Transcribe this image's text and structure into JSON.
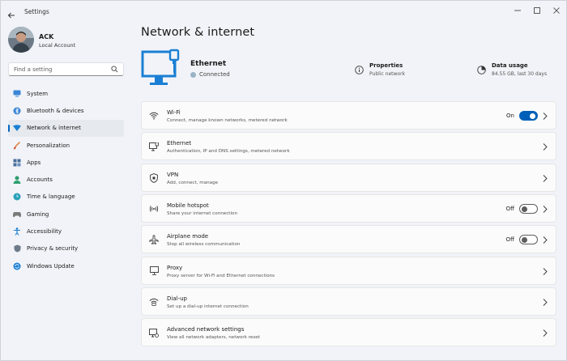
{
  "window": {
    "title": "Settings"
  },
  "user": {
    "name": "ACK",
    "account": "Local Account"
  },
  "search": {
    "placeholder": "Find a setting"
  },
  "sidebar": {
    "items": [
      {
        "label": "System",
        "icon": "system-icon"
      },
      {
        "label": "Bluetooth & devices",
        "icon": "bluetooth-icon"
      },
      {
        "label": "Network & internet",
        "icon": "network-icon",
        "active": true
      },
      {
        "label": "Personalization",
        "icon": "brush-icon"
      },
      {
        "label": "Apps",
        "icon": "apps-icon"
      },
      {
        "label": "Accounts",
        "icon": "accounts-icon"
      },
      {
        "label": "Time & language",
        "icon": "globe-clock-icon"
      },
      {
        "label": "Gaming",
        "icon": "gamepad-icon"
      },
      {
        "label": "Accessibility",
        "icon": "accessibility-icon"
      },
      {
        "label": "Privacy & security",
        "icon": "shield-icon"
      },
      {
        "label": "Windows Update",
        "icon": "update-icon"
      }
    ]
  },
  "page": {
    "title": "Network & internet"
  },
  "hero": {
    "name": "Ethernet",
    "status": "Connected",
    "properties": {
      "title": "Properties",
      "subtitle": "Public network"
    },
    "data_usage": {
      "title": "Data usage",
      "subtitle": "84.55 GB, last 30 days"
    }
  },
  "rows": [
    {
      "title": "Wi-Fi",
      "subtitle": "Connect, manage known networks, metered network",
      "icon": "wifi-icon",
      "toggle": "On"
    },
    {
      "title": "Ethernet",
      "subtitle": "Authentication, IP and DNS settings, metered network",
      "icon": "ethernet-icon"
    },
    {
      "title": "VPN",
      "subtitle": "Add, connect, manage",
      "icon": "vpn-shield-icon"
    },
    {
      "title": "Mobile hotspot",
      "subtitle": "Share your internet connection",
      "icon": "hotspot-icon",
      "toggle": "Off"
    },
    {
      "title": "Airplane mode",
      "subtitle": "Stop all wireless communication",
      "icon": "airplane-icon",
      "toggle": "Off"
    },
    {
      "title": "Proxy",
      "subtitle": "Proxy server for Wi-Fi and Ethernet connections",
      "icon": "proxy-icon"
    },
    {
      "title": "Dial-up",
      "subtitle": "Set up a dial-up internet connection",
      "icon": "dialup-icon"
    },
    {
      "title": "Advanced network settings",
      "subtitle": "View all network adapters, network reset",
      "icon": "advanced-network-icon"
    }
  ],
  "colors": {
    "accent": "#0067c0",
    "toggle_on": "#005fb8",
    "hero_icon": "#1a7fd4"
  }
}
